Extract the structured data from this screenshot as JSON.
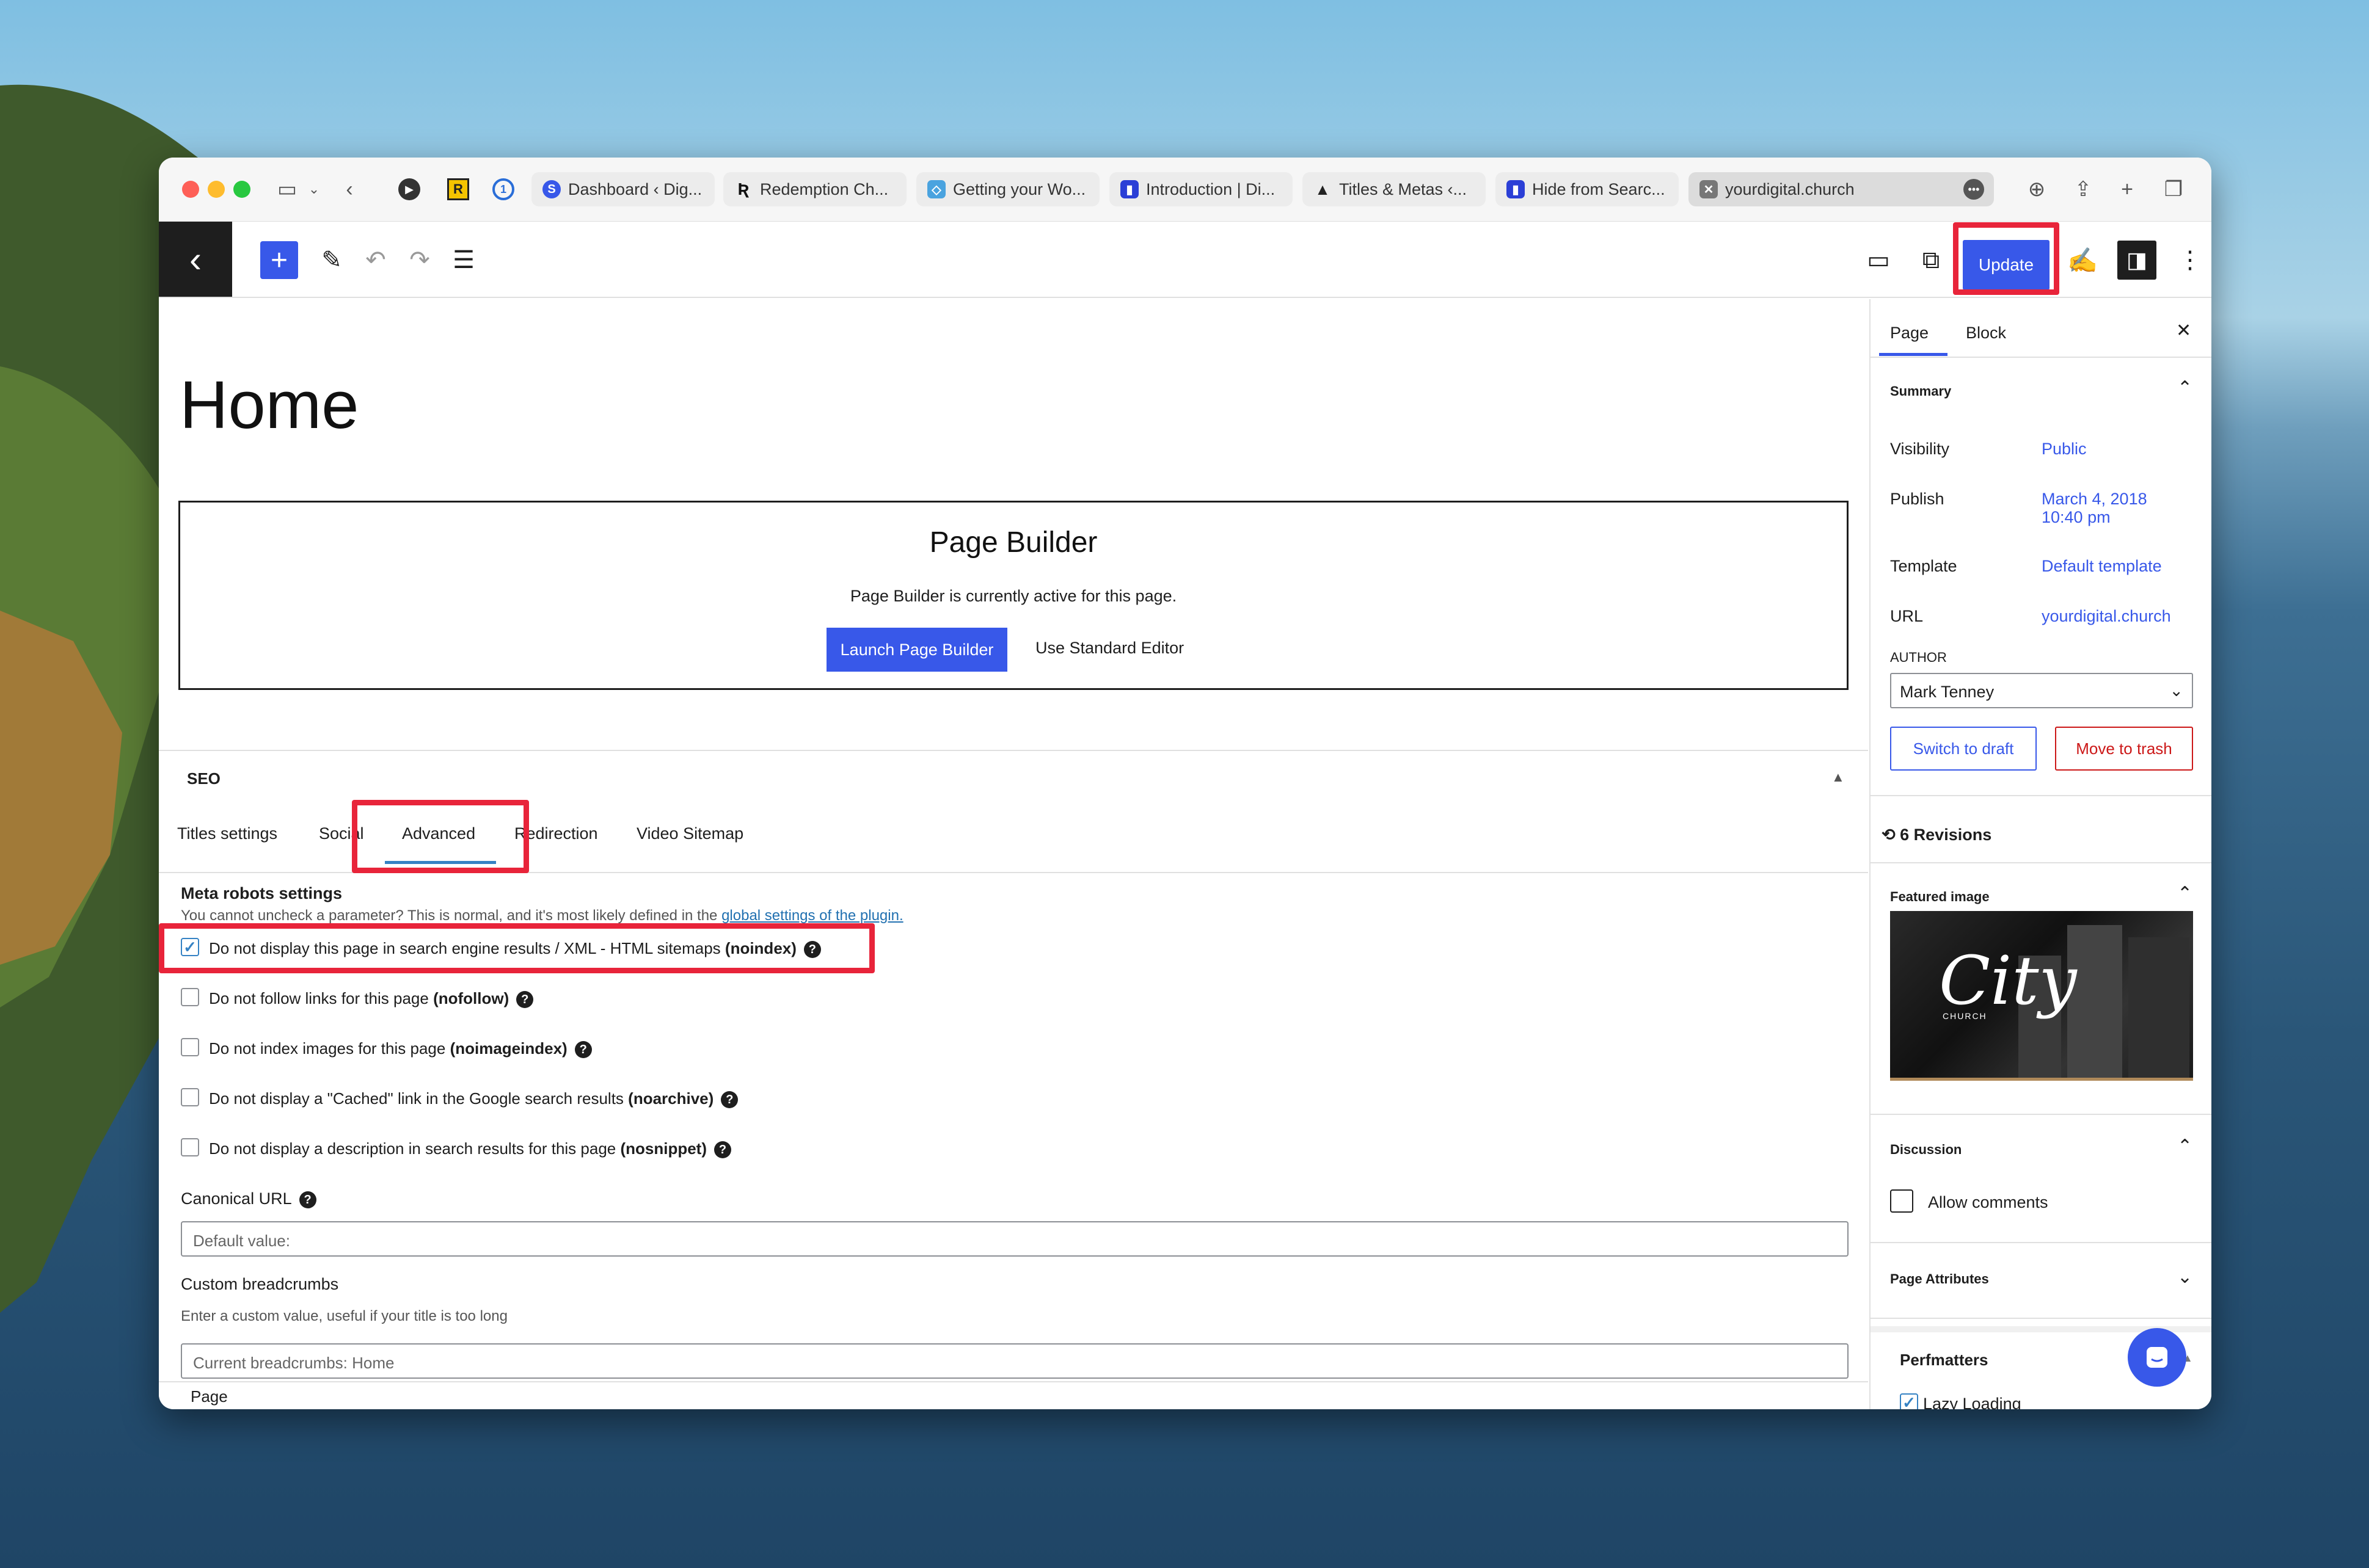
{
  "browser": {
    "tabs": [
      {
        "label": "Dashboard ‹ Dig..."
      },
      {
        "label": "Redemption Ch..."
      },
      {
        "label": "Getting your Wo..."
      },
      {
        "label": "Introduction | Di..."
      },
      {
        "label": "Titles & Metas ‹..."
      },
      {
        "label": "Hide from Searc..."
      },
      {
        "label": "yourdigital.church"
      }
    ],
    "ext_r": "R"
  },
  "toolbar": {
    "update_label": "Update"
  },
  "editor": {
    "page_title": "Home",
    "page_builder": {
      "heading": "Page Builder",
      "text": "Page Builder is currently active for this page.",
      "launch_label": "Launch Page Builder",
      "standard_label": "Use Standard Editor"
    },
    "seo": {
      "heading": "SEO",
      "tabs": [
        "Titles settings",
        "Social",
        "Advanced",
        "Redirection",
        "Video Sitemap"
      ],
      "meta_robots_heading": "Meta robots settings",
      "meta_robots_note": "You cannot uncheck a parameter? This is normal, and it's most likely defined in the ",
      "meta_robots_link": "global settings of the plugin.",
      "options": [
        {
          "text": "Do not display this page in search engine results / XML - HTML sitemaps ",
          "bold": "(noindex)",
          "checked": true
        },
        {
          "text": "Do not follow links for this page ",
          "bold": "(nofollow)",
          "checked": false
        },
        {
          "text": "Do not index images for this page ",
          "bold": "(noimageindex)",
          "checked": false
        },
        {
          "text": "Do not display a \"Cached\" link in the Google search results ",
          "bold": "(noarchive)",
          "checked": false
        },
        {
          "text": "Do not display a description in search results for this page ",
          "bold": "(nosnippet)",
          "checked": false
        }
      ],
      "canonical_label": "Canonical URL",
      "canonical_placeholder": "Default value:",
      "breadcrumbs_label": "Custom breadcrumbs",
      "breadcrumbs_note": "Enter a custom value, useful if your title is too long",
      "breadcrumbs_placeholder": "Current breadcrumbs: Home"
    },
    "footer_label": "Page"
  },
  "sidebar": {
    "tabs": [
      "Page",
      "Block"
    ],
    "summary_heading": "Summary",
    "visibility_label": "Visibility",
    "visibility_value": "Public",
    "publish_label": "Publish",
    "publish_value_1": "March 4, 2018",
    "publish_value_2": "10:40 pm",
    "template_label": "Template",
    "template_value": "Default template",
    "url_label": "URL",
    "url_value": "yourdigital.church",
    "author_label": "AUTHOR",
    "author_value": "Mark Tenney",
    "draft_label": "Switch to draft",
    "trash_label": "Move to trash",
    "revisions_label": "6 Revisions",
    "featured_heading": "Featured image",
    "featured_logo_main": "City",
    "featured_logo_sub": "CHURCH",
    "discussion_heading": "Discussion",
    "allow_comments": "Allow comments",
    "page_attributes_heading": "Page Attributes",
    "perfmatters_heading": "Perfmatters",
    "lazy_loading": "Lazy Loading"
  },
  "colors": {
    "accent": "#3858e9",
    "highlight": "#e8243a",
    "trash": "#cc1818"
  }
}
